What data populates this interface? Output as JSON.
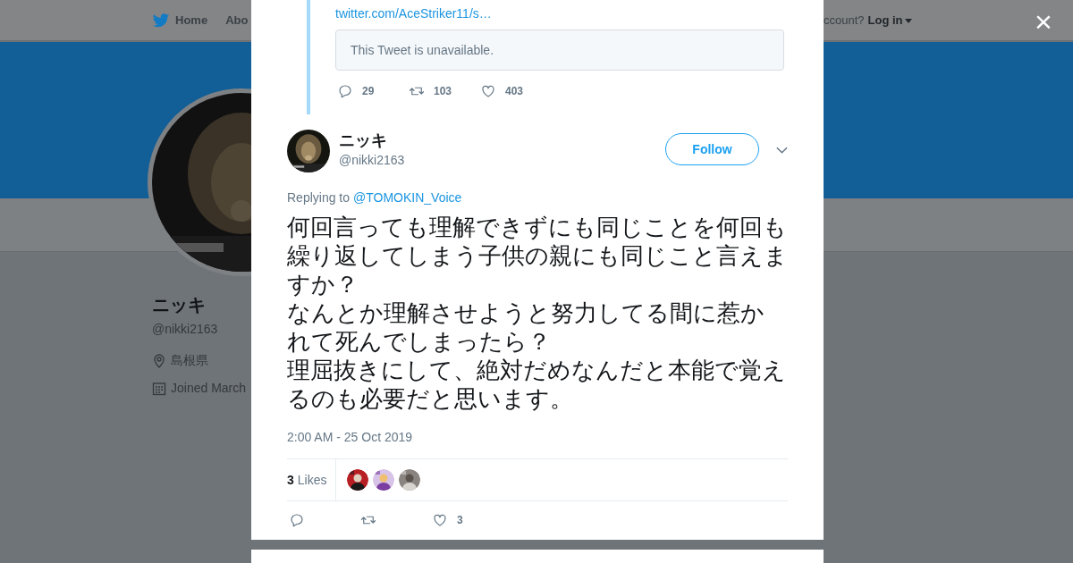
{
  "top_nav": {
    "items": [
      {
        "label": "Home",
        "kind": "home"
      },
      {
        "label": "Abo",
        "kind": "plain"
      }
    ],
    "account_prompt": "ccount?",
    "login": "Log in"
  },
  "profile": {
    "name": "ニッキ",
    "handle": "@nikki2163",
    "location": "島根県",
    "joined": "Joined March"
  },
  "modal": {
    "quoted": {
      "link": "twitter.com/AceStriker11/s…",
      "unavailable": "This Tweet is unavailable.",
      "actions": [
        {
          "kind": "reply",
          "count": "29"
        },
        {
          "kind": "retweet",
          "count": "103"
        },
        {
          "kind": "like",
          "count": "403"
        }
      ]
    },
    "tweet": {
      "name": "ニッキ",
      "handle": "@nikki2163",
      "follow": "Follow",
      "replying_label": "Replying to",
      "replying_to": "@TOMOKIN_Voice",
      "text_lines": [
        "何回言っても理解できずにも同じことを何回も繰り返してしまう子供の親にも同じこと言えますか？",
        "なんとか理解させようと努力してる間に惹かれて死んでしまったら？",
        "理屈抜きにして、絶対だめなんだと本能で覚えるのも必要だと思います。"
      ],
      "time": "2:00 AM - 25 Oct 2019",
      "likes_count": "3",
      "likes_label": "Likes",
      "actions": [
        {
          "kind": "reply"
        },
        {
          "kind": "retweet"
        },
        {
          "kind": "like",
          "count": "3"
        }
      ]
    },
    "close": "×"
  }
}
